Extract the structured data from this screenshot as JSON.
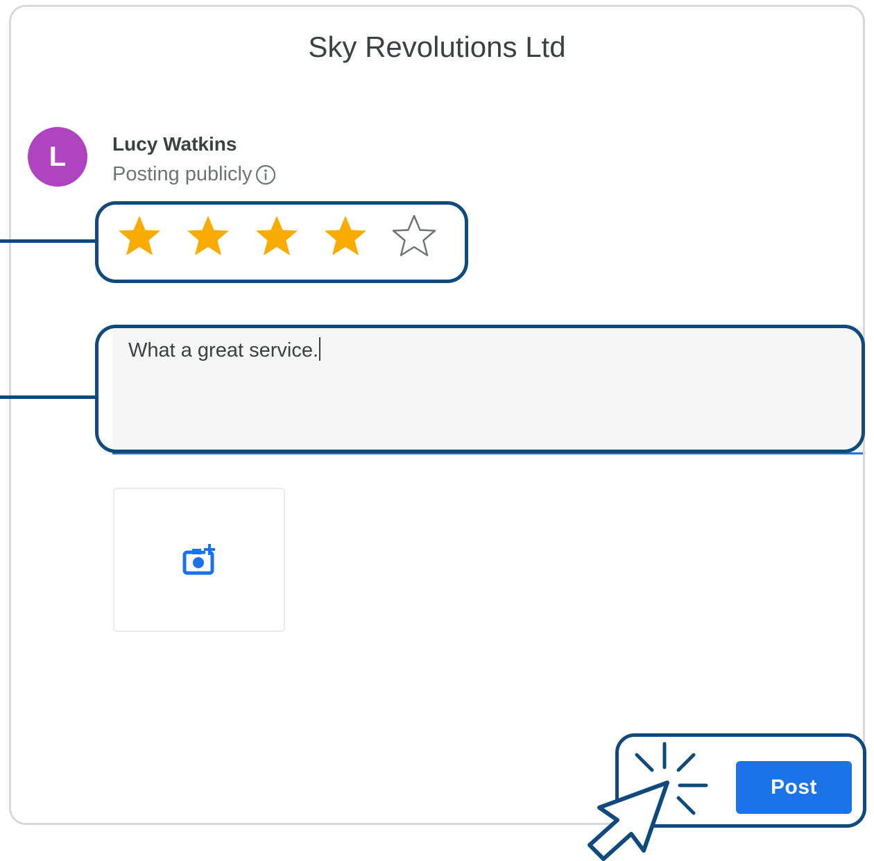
{
  "dialog": {
    "title": "Sky Revolutions Ltd"
  },
  "user": {
    "avatar_initial": "L",
    "avatar_color": "#b043bf",
    "name": "Lucy Watkins",
    "posting_status": "Posting publicly"
  },
  "rating": {
    "value": 4,
    "max": 5,
    "filled_color": "#f9ab00",
    "empty_color": "#6f7378"
  },
  "review": {
    "text": "What a great service."
  },
  "photo": {
    "icon": "add-photo-icon"
  },
  "actions": {
    "post_label": "Post"
  },
  "colors": {
    "accent": "#1a73e8",
    "callout": "#0e4a7b"
  }
}
